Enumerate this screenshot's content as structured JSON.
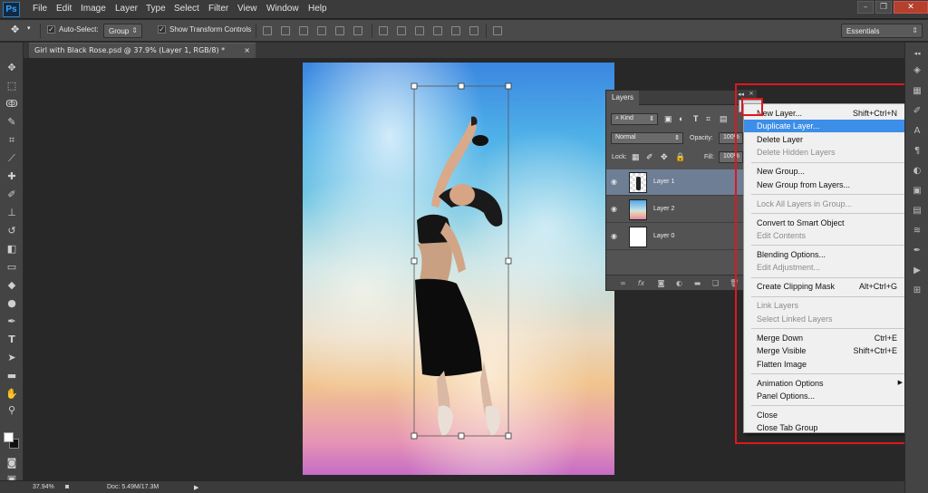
{
  "app": {
    "logo": "Ps"
  },
  "menu": [
    "File",
    "Edit",
    "Image",
    "Layer",
    "Type",
    "Select",
    "Filter",
    "View",
    "Window",
    "Help"
  ],
  "window_controls": {
    "minimize": "–",
    "restore": "❐",
    "close": "✕"
  },
  "options_bar": {
    "auto_select_label": "Auto-Select:",
    "auto_select_checked": true,
    "auto_select_target": "Group",
    "show_transform_label": "Show Transform Controls",
    "show_transform_checked": true,
    "workspace": "Essentials"
  },
  "document_tab": {
    "title": "Girl with Black Rose.psd @ 37.9% (Layer 1, RGB/8) *",
    "close": "×"
  },
  "layers_panel": {
    "tab": "Layers",
    "filter_kind": "Kind",
    "blend_mode": "Normal",
    "opacity_label": "Opacity:",
    "opacity_value": "100%",
    "lock_label": "Lock:",
    "fill_label": "Fill:",
    "fill_value": "100%",
    "layers": [
      {
        "name": "Layer 1",
        "selected": true,
        "thumb": "person"
      },
      {
        "name": "Layer 2",
        "selected": false,
        "thumb": "sky"
      },
      {
        "name": "Layer 0",
        "selected": false,
        "thumb": "white"
      }
    ],
    "footer_icons": [
      "link-icon",
      "fx-icon",
      "mask-icon",
      "adjustment-icon",
      "folder-icon",
      "new-layer-icon",
      "trash-icon"
    ]
  },
  "panel_header": {
    "collapse": "◂◂",
    "close": "×"
  },
  "context_menu": {
    "groups": [
      [
        {
          "label": "New Layer...",
          "shortcut": "Shift+Ctrl+N",
          "disabled": false
        },
        {
          "label": "Duplicate Layer...",
          "shortcut": "",
          "disabled": false,
          "highlighted": true
        },
        {
          "label": "Delete Layer",
          "shortcut": "",
          "disabled": false
        },
        {
          "label": "Delete Hidden Layers",
          "shortcut": "",
          "disabled": true
        }
      ],
      [
        {
          "label": "New Group...",
          "shortcut": "",
          "disabled": false
        },
        {
          "label": "New Group from Layers...",
          "shortcut": "",
          "disabled": false
        }
      ],
      [
        {
          "label": "Lock All Layers in Group...",
          "shortcut": "",
          "disabled": true
        }
      ],
      [
        {
          "label": "Convert to Smart Object",
          "shortcut": "",
          "disabled": false
        },
        {
          "label": "Edit Contents",
          "shortcut": "",
          "disabled": true
        }
      ],
      [
        {
          "label": "Blending Options...",
          "shortcut": "",
          "disabled": false
        },
        {
          "label": "Edit Adjustment...",
          "shortcut": "",
          "disabled": true
        }
      ],
      [
        {
          "label": "Create Clipping Mask",
          "shortcut": "Alt+Ctrl+G",
          "disabled": false
        }
      ],
      [
        {
          "label": "Link Layers",
          "shortcut": "",
          "disabled": true
        },
        {
          "label": "Select Linked Layers",
          "shortcut": "",
          "disabled": true
        }
      ],
      [
        {
          "label": "Merge Down",
          "shortcut": "Ctrl+E",
          "disabled": false
        },
        {
          "label": "Merge Visible",
          "shortcut": "Shift+Ctrl+E",
          "disabled": false
        },
        {
          "label": "Flatten Image",
          "shortcut": "",
          "disabled": false
        }
      ],
      [
        {
          "label": "Animation Options",
          "shortcut": "",
          "disabled": false,
          "submenu": true
        },
        {
          "label": "Panel Options...",
          "shortcut": "",
          "disabled": false
        }
      ],
      [
        {
          "label": "Close",
          "shortcut": "",
          "disabled": false
        },
        {
          "label": "Close Tab Group",
          "shortcut": "",
          "disabled": false
        }
      ]
    ]
  },
  "status_bar": {
    "zoom": "37.94%",
    "doc": "Doc: 5.49M/17.3M"
  },
  "colors": {
    "highlight": "#3d8ee8",
    "annotation": "#e0161e",
    "selected_layer": "#6e7e95"
  }
}
